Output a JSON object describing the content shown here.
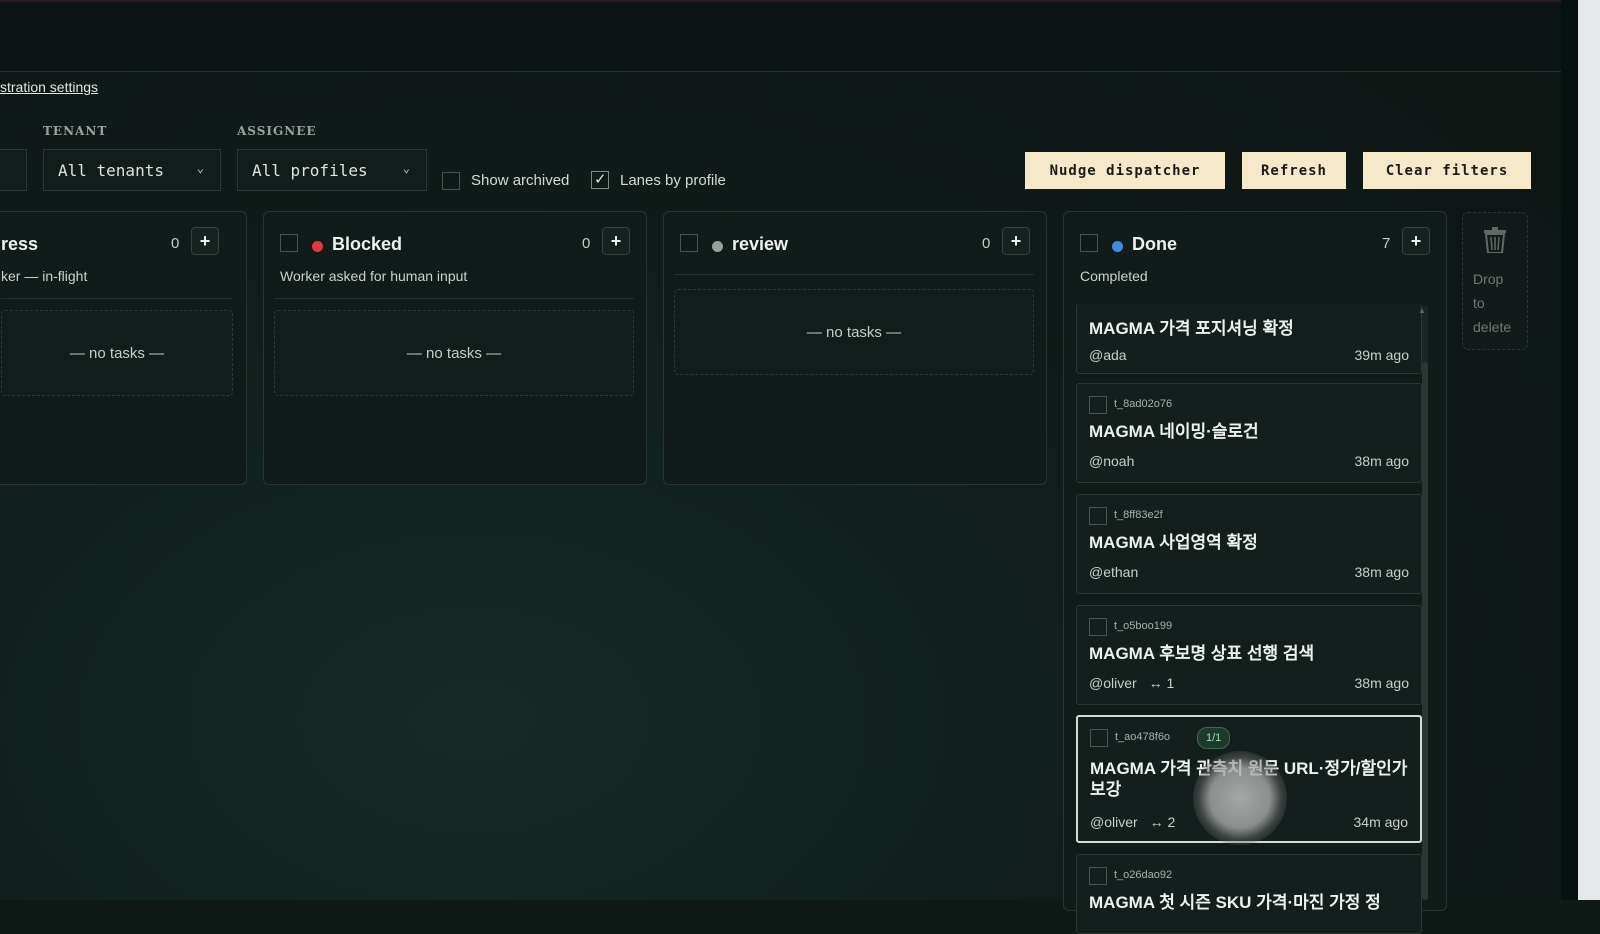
{
  "breadcrumb": "stration settings",
  "filters": {
    "tenant_label": "TENANT",
    "tenant_value": "All tenants",
    "assignee_label": "ASSIGNEE",
    "assignee_value": "All profiles",
    "show_archived_label": "Show archived",
    "show_archived_checked": false,
    "lanes_by_profile_label": "Lanes by profile",
    "lanes_by_profile_checked": true
  },
  "actions": {
    "nudge": "Nudge dispatcher",
    "refresh": "Refresh",
    "clear": "Clear filters"
  },
  "columns": {
    "in_progress": {
      "title": "ress",
      "count": "0",
      "subtitle": "ker — in-flight",
      "empty": "— no tasks —"
    },
    "blocked": {
      "title": "Blocked",
      "count": "0",
      "subtitle": "Worker asked for human input",
      "empty": "— no tasks —",
      "dot_color": "#e03a3e"
    },
    "review": {
      "title": "review",
      "count": "0",
      "empty": "— no tasks —",
      "dot_color": "#9aa09d"
    },
    "done": {
      "title": "Done",
      "count": "7",
      "subtitle": "Completed",
      "dot_color": "#3b8ee0",
      "cards": [
        {
          "id": "",
          "title": "MAGMA 가격 포지셔닝 확정",
          "assignee": "@ada",
          "links": "",
          "time": "39m ago"
        },
        {
          "id": "t_8ad02o76",
          "title": "MAGMA 네이밍·슬로건",
          "assignee": "@noah",
          "links": "",
          "time": "38m ago"
        },
        {
          "id": "t_8ff83e2f",
          "title": "MAGMA 사업영역 확정",
          "assignee": "@ethan",
          "links": "",
          "time": "38m ago"
        },
        {
          "id": "t_o5boo199",
          "title": "MAGMA 후보명 상표 선행 검색",
          "assignee": "@oliver",
          "links": "↔ 1",
          "time": "38m ago"
        },
        {
          "id": "t_ao478f6o",
          "badge": "1/1",
          "title": "MAGMA 가격 관측치 원문 URL·정가/할인가 보강",
          "assignee": "@oliver",
          "links": "↔ 2",
          "time": "34m ago"
        },
        {
          "id": "t_o26dao92",
          "title": "MAGMA 첫 시즌 SKU 가격·마진 가정 정",
          "assignee": "",
          "links": "",
          "time": ""
        }
      ]
    }
  },
  "trash": {
    "line1": "Drop",
    "line2": "to",
    "line3": "delete"
  }
}
